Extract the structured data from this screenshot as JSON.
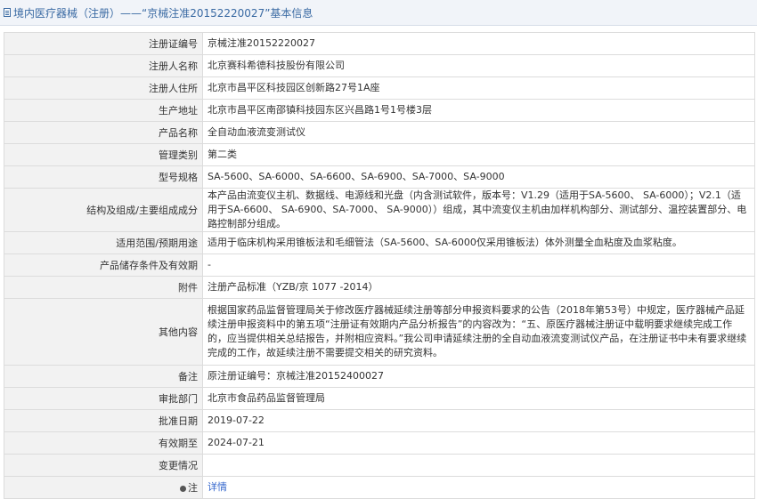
{
  "header": {
    "title": "境内医疗器械（注册）——“京械注准20152220027”基本信息"
  },
  "rows": [
    {
      "label": "注册证编号",
      "value": "京械注准20152220027"
    },
    {
      "label": "注册人名称",
      "value": "北京赛科希德科技股份有限公司"
    },
    {
      "label": "注册人住所",
      "value": "北京市昌平区科技园区创新路27号1A座"
    },
    {
      "label": "生产地址",
      "value": "北京市昌平区南邵镇科技园东区兴昌路1号1号楼3层"
    },
    {
      "label": "产品名称",
      "value": "全自动血液流变测试仪"
    },
    {
      "label": "管理类别",
      "value": "第二类"
    },
    {
      "label": "型号规格",
      "value": "SA-5600、SA-6000、SA-6600、SA-6900、SA-7000、SA-9000"
    },
    {
      "label": "结构及组成/主要组成成分",
      "value": "本产品由流变仪主机、数据线、电源线和光盘（内含测试软件，版本号：V1.29（适用于SA-5600、 SA-6000）；V2.1（适用于SA-6600、 SA-6900、SA-7000、 SA-9000））组成，其中流变仪主机由加样机构部分、测试部分、温控装置部分、电路控制部分组成。"
    },
    {
      "label": "适用范围/预期用途",
      "value": "适用于临床机构采用锥板法和毛细管法（SA-5600、SA-6000仅采用锥板法）体外测量全血粘度及血浆粘度。"
    },
    {
      "label": "产品储存条件及有效期",
      "value": "-"
    },
    {
      "label": "附件",
      "value": "注册产品标准（YZB/京 1077 -2014）"
    },
    {
      "label": "其他内容",
      "value": "根据国家药品监督管理局关于修改医疗器械延续注册等部分申报资料要求的公告（2018年第53号）中规定，医疗器械产品延续注册申报资料中的第五项“注册证有效期内产品分析报告”的内容改为：“五、原医疗器械注册证中载明要求继续完成工作的，应当提供相关总结报告，并附相应资料。”我公司申请延续注册的全自动血液流变测试仪产品，在注册证书中未有要求继续完成的工作，故延续注册不需要提交相关的研究资料。"
    },
    {
      "label": "备注",
      "value": "原注册证编号：京械注准20152400027"
    },
    {
      "label": "审批部门",
      "value": "北京市食品药品监督管理局"
    },
    {
      "label": "批准日期",
      "value": "2019-07-22"
    },
    {
      "label": "有效期至",
      "value": "2024-07-21"
    },
    {
      "label": "变更情况",
      "value": ""
    }
  ],
  "note": {
    "label": "注",
    "link": "详情"
  }
}
